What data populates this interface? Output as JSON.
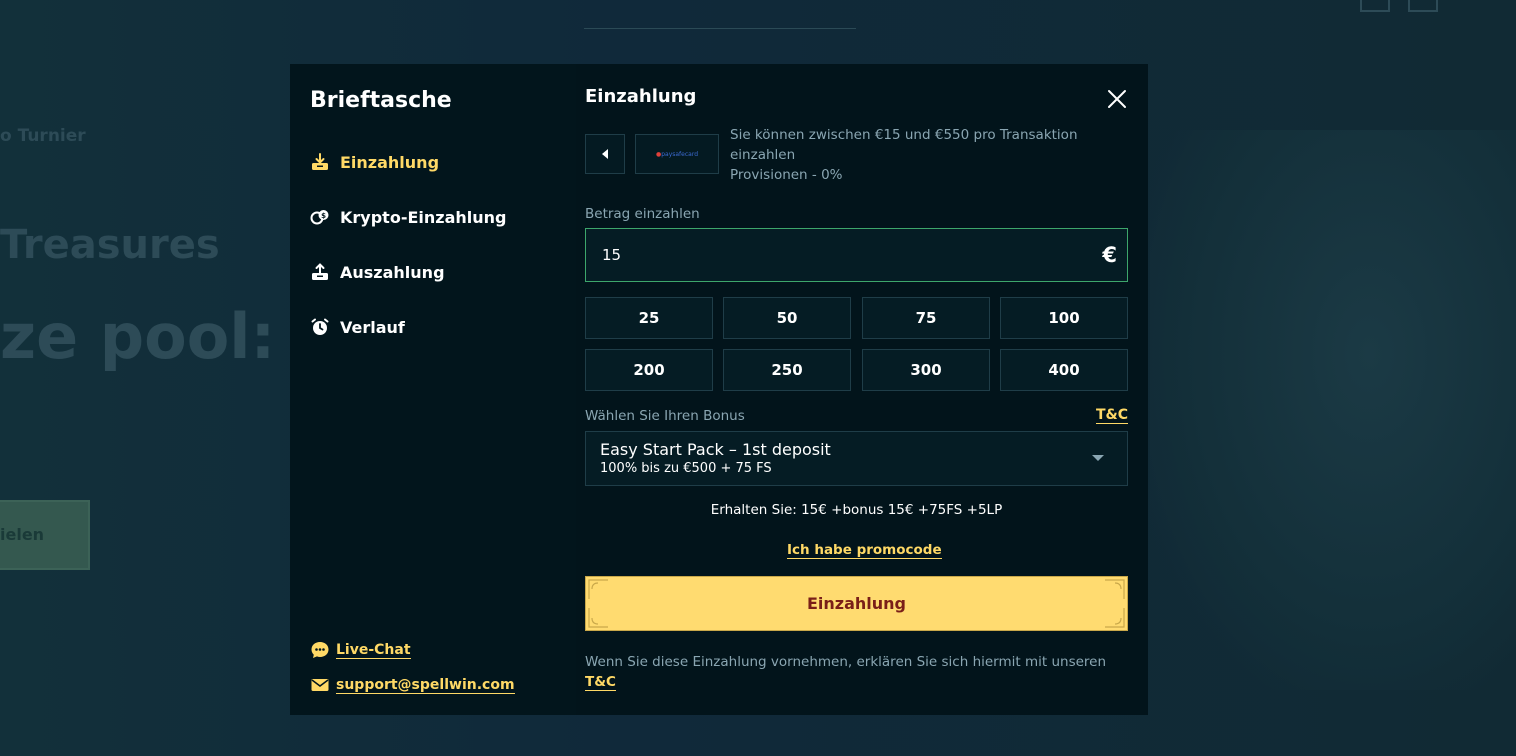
{
  "background": {
    "turnier_text": "o Turnier",
    "treasures_text": "Treasures",
    "prize_text": "ze pool: €",
    "play_button_label": "ielen"
  },
  "sidebar": {
    "title": "Brieftasche",
    "items": [
      {
        "label": "Einzahlung",
        "icon": "deposit-icon",
        "active": true
      },
      {
        "label": "Krypto-Einzahlung",
        "icon": "crypto-icon",
        "active": false
      },
      {
        "label": "Auszahlung",
        "icon": "withdraw-icon",
        "active": false
      },
      {
        "label": "Verlauf",
        "icon": "alarm-clock-icon",
        "active": false
      }
    ],
    "live_chat": "Live-Chat",
    "support_email": "support@spellwin.com"
  },
  "content": {
    "title": "Einzahlung",
    "provider": {
      "logo_text": "paysafecard",
      "info_line1": "Sie können zwischen €15 und €550 pro Transaktion einzahlen",
      "info_line2": "Provisionen - 0%"
    },
    "amount": {
      "label": "Betrag einzahlen",
      "value": "15",
      "currency": "€"
    },
    "quick_amounts": [
      "25",
      "50",
      "75",
      "100",
      "200",
      "250",
      "300",
      "400"
    ],
    "bonus": {
      "label": "Wählen Sie Ihren Bonus",
      "tc_label": "T&C",
      "selected_name": "Easy Start Pack – 1st deposit",
      "selected_desc": "100% bis zu €500 + 75 FS"
    },
    "receive_text": "Erhalten Sie: 15€ +bonus 15€ +75FS +5LP",
    "promo_link": "Ich habe promocode",
    "submit_label": "Einzahlung",
    "disclaimer_text": "Wenn Sie diese Einzahlung vornehmen, erklären Sie sich hiermit mit unseren",
    "disclaimer_link": "T&C"
  },
  "colors": {
    "accent": "#ffd966",
    "input_border_active": "#3da66b",
    "submit_text": "#7a1f18"
  }
}
